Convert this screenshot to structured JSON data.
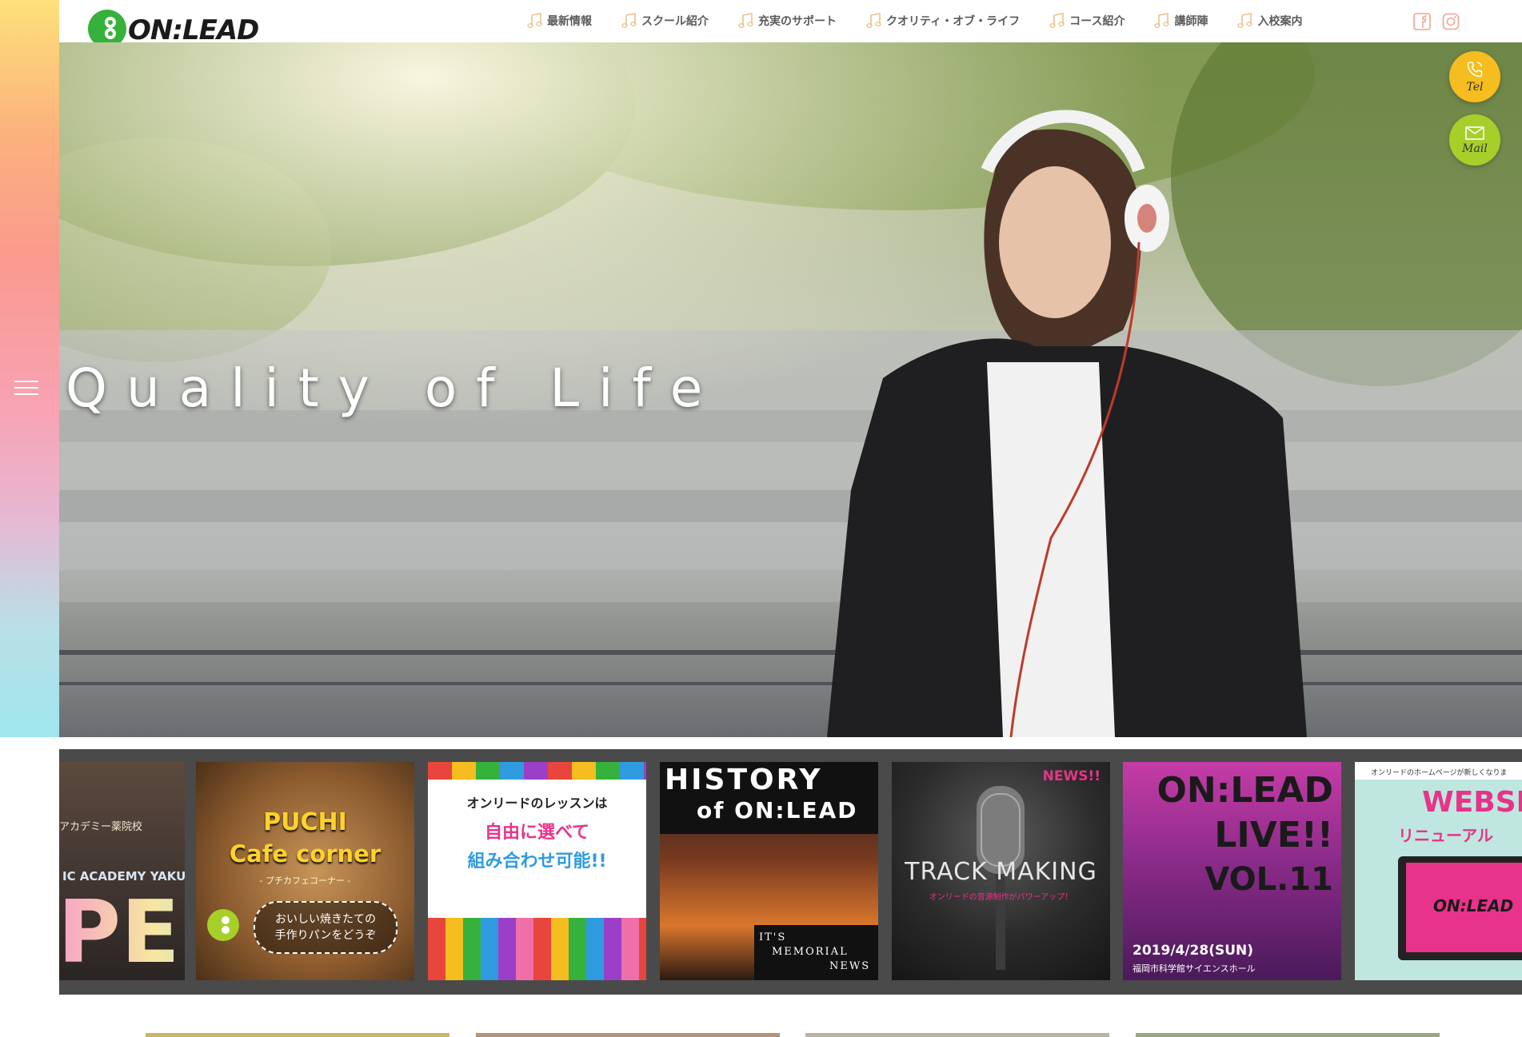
{
  "header": {
    "logo_text": "ON:LEAD",
    "nav": [
      {
        "label": "最新情報"
      },
      {
        "label": "スクール紹介"
      },
      {
        "label": "充実のサポート"
      },
      {
        "label": "クオリティ・オブ・ライフ"
      },
      {
        "label": "コース紹介"
      },
      {
        "label": "講師陣"
      },
      {
        "label": "入校案内"
      }
    ],
    "social": [
      "facebook-icon",
      "instagram-icon"
    ]
  },
  "hero": {
    "tagline": "Quality of Life"
  },
  "floating": {
    "tel_label": "Tel",
    "mail_label": "Mail"
  },
  "carousel": {
    "cards": [
      {
        "line1": "アカデミー薬院校",
        "line2": "IC ACADEMY YAKUIN",
        "line3": "PEN"
      },
      {
        "title1": "PUCHI",
        "title2": "Cafe corner",
        "sub": "- プチカフェコーナー -",
        "body1": "おいしい焼きたての",
        "body2": "手作りパンをどうぞ"
      },
      {
        "line1": "オンリードのレッスンは",
        "line2": "自由に選べて",
        "line3": "組み合わせ可能!!"
      },
      {
        "title1": "HISTORY",
        "title2": "of ON:LEAD",
        "foot1": "IT'S",
        "foot2": "MEMORIAL",
        "foot3": "NEWS"
      },
      {
        "badge": "NEWS!!",
        "title": "TRACK MAKING",
        "sub": "オンリードの音源制作がパワーアップ！"
      },
      {
        "title1": "ON:LEAD",
        "title2": "LIVE!!",
        "title3": "VOL.11",
        "date": "2019/4/28(SUN)",
        "venue": "福岡市科学館サイエンスホール"
      },
      {
        "top": "オンリードのホームページが新しくなりま",
        "title1": "WEBSITE",
        "title2": "リニューアル",
        "logo": "ON:LEAD"
      }
    ]
  },
  "colors": {
    "accent_yellow": "#f5bd1f",
    "accent_green": "#a6cf2a",
    "logo_green": "#36b13c",
    "strip_bg": "#4a4a4a"
  }
}
